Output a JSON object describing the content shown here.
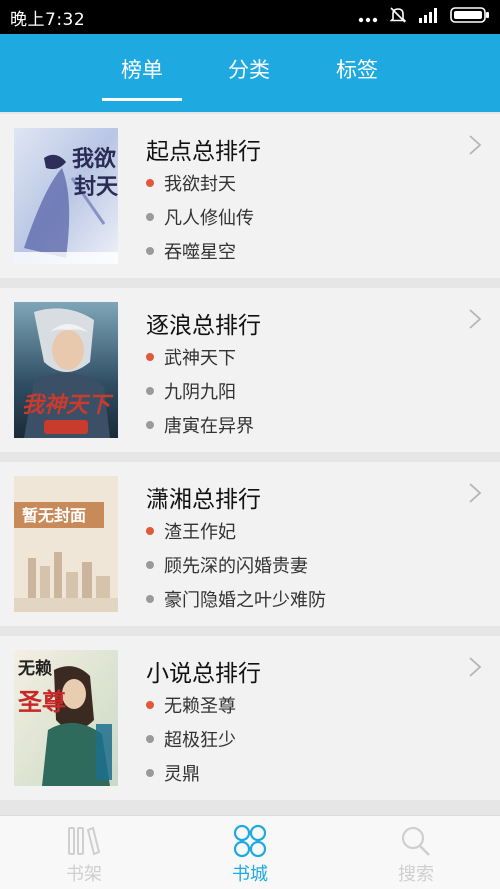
{
  "status": {
    "time": "晚上7:32"
  },
  "tabs": [
    {
      "label": "榜单",
      "active": true
    },
    {
      "label": "分类",
      "active": false
    },
    {
      "label": "标签",
      "active": false
    }
  ],
  "rankings": [
    {
      "title": "起点总排行",
      "books": [
        "我欲封天",
        "凡人修仙传",
        "吞噬星空"
      ],
      "cover_text": "我欲封天"
    },
    {
      "title": "逐浪总排行",
      "books": [
        "武神天下",
        "九阴九阳",
        "唐寅在异界"
      ],
      "cover_text": "我神天下"
    },
    {
      "title": "潇湘总排行",
      "books": [
        "渣王作妃",
        "顾先深的闪婚贵妻",
        "豪门隐婚之叶少难防"
      ],
      "cover_text": "暂无封面"
    },
    {
      "title": "小说总排行",
      "books": [
        "无赖圣尊",
        "超极狂少",
        "灵鼎"
      ],
      "cover_text": "无赖圣尊"
    }
  ],
  "bottom_nav": [
    {
      "label": "书架",
      "icon": "bookshelf-icon",
      "active": false
    },
    {
      "label": "书城",
      "icon": "bookstore-icon",
      "active": true
    },
    {
      "label": "搜索",
      "icon": "search-icon",
      "active": false
    }
  ],
  "colors": {
    "accent": "#1fa9e1",
    "first_rank_dot": "#e05a3a",
    "rank_dot": "#9a9a9a"
  }
}
